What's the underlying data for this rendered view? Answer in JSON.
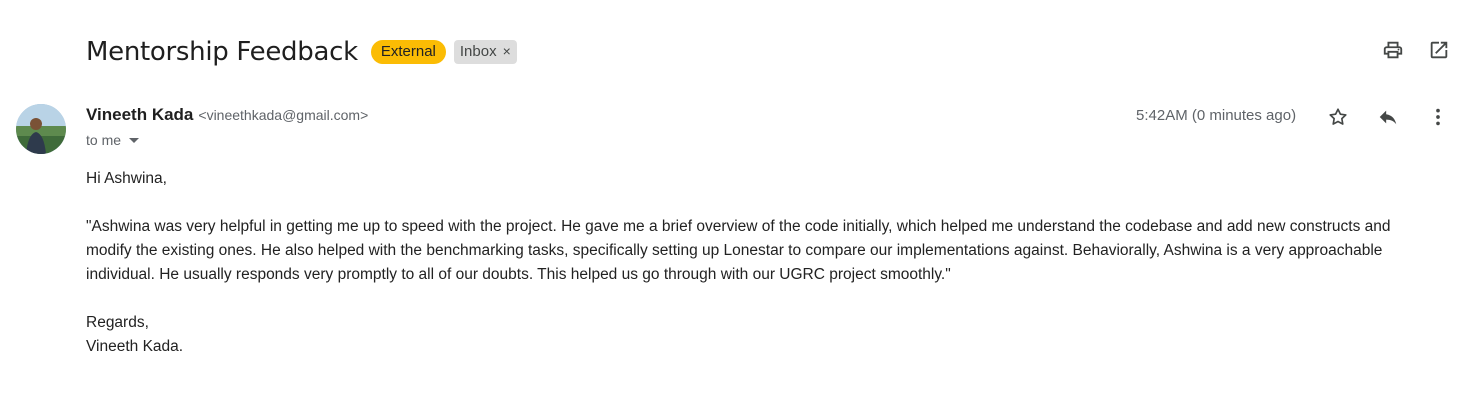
{
  "subject": "Mentorship Feedback",
  "labels": {
    "external": "External",
    "inbox": "Inbox",
    "remove_symbol": "×"
  },
  "toolbar": {
    "print_icon": "print-icon",
    "open_new_window_icon": "open-in-new-icon"
  },
  "sender": {
    "name": "Vineeth Kada",
    "email": "<vineethkada@gmail.com>",
    "recipient": "to me"
  },
  "time": "5:42AM (0 minutes ago)",
  "message_actions": {
    "star": "star-icon",
    "reply": "reply-icon",
    "more": "more-vert-icon"
  },
  "body": {
    "greeting": "Hi Ashwina,",
    "paragraph": "\"Ashwina was very helpful in getting me up to speed with the project. He gave me a brief overview of the code initially, which helped me understand the codebase and add new constructs and modify the existing ones. He also helped with the benchmarking tasks, specifically setting up Lonestar to compare our implementations against. Behaviorally, Ashwina is a very approachable individual. He usually responds very promptly to all of our doubts. This helped us go through with our UGRC project smoothly.\"",
    "closing": "Regards,",
    "signature": "Vineeth Kada."
  },
  "colors": {
    "external_chip": "#fbbc04",
    "inbox_chip": "#dddddd",
    "meta_text": "#5f6368"
  }
}
